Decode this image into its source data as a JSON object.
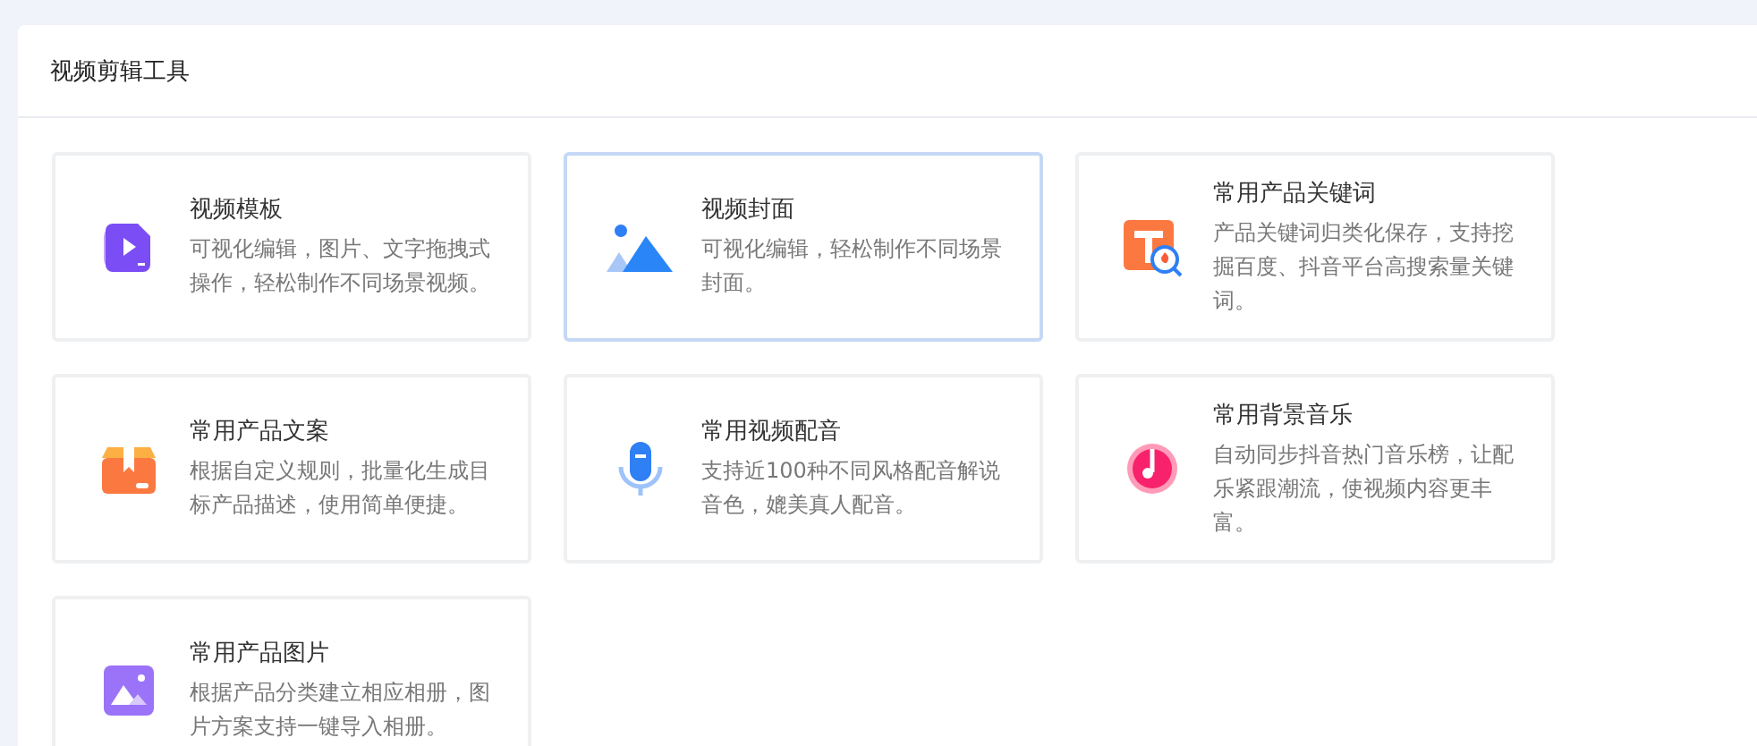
{
  "panel": {
    "title": "视频剪辑工具"
  },
  "tools": [
    {
      "title": "视频模板",
      "description": "可视化编辑，图片、文字拖拽式操作，轻松制作不同场景视频。",
      "selected": false
    },
    {
      "title": "视频封面",
      "description": "可视化编辑，轻松制作不同场景封面。",
      "selected": true
    },
    {
      "title": "常用产品关键词",
      "description": "产品关键词归类化保存，支持挖掘百度、抖音平台高搜索量关键词。",
      "selected": false
    },
    {
      "title": "常用产品文案",
      "description": "根据自定义规则，批量化生成目标产品描述，使用简单便捷。",
      "selected": false
    },
    {
      "title": "常用视频配音",
      "description": "支持近100种不同风格配音解说音色，媲美真人配音。",
      "selected": false
    },
    {
      "title": "常用背景音乐",
      "description": "自动同步抖音热门音乐榜，让配乐紧跟潮流，使视频内容更丰富。",
      "selected": false
    },
    {
      "title": "常用产品图片",
      "description": "根据产品分类建立相应相册，图片方案支持一键导入相册。",
      "selected": false
    }
  ]
}
